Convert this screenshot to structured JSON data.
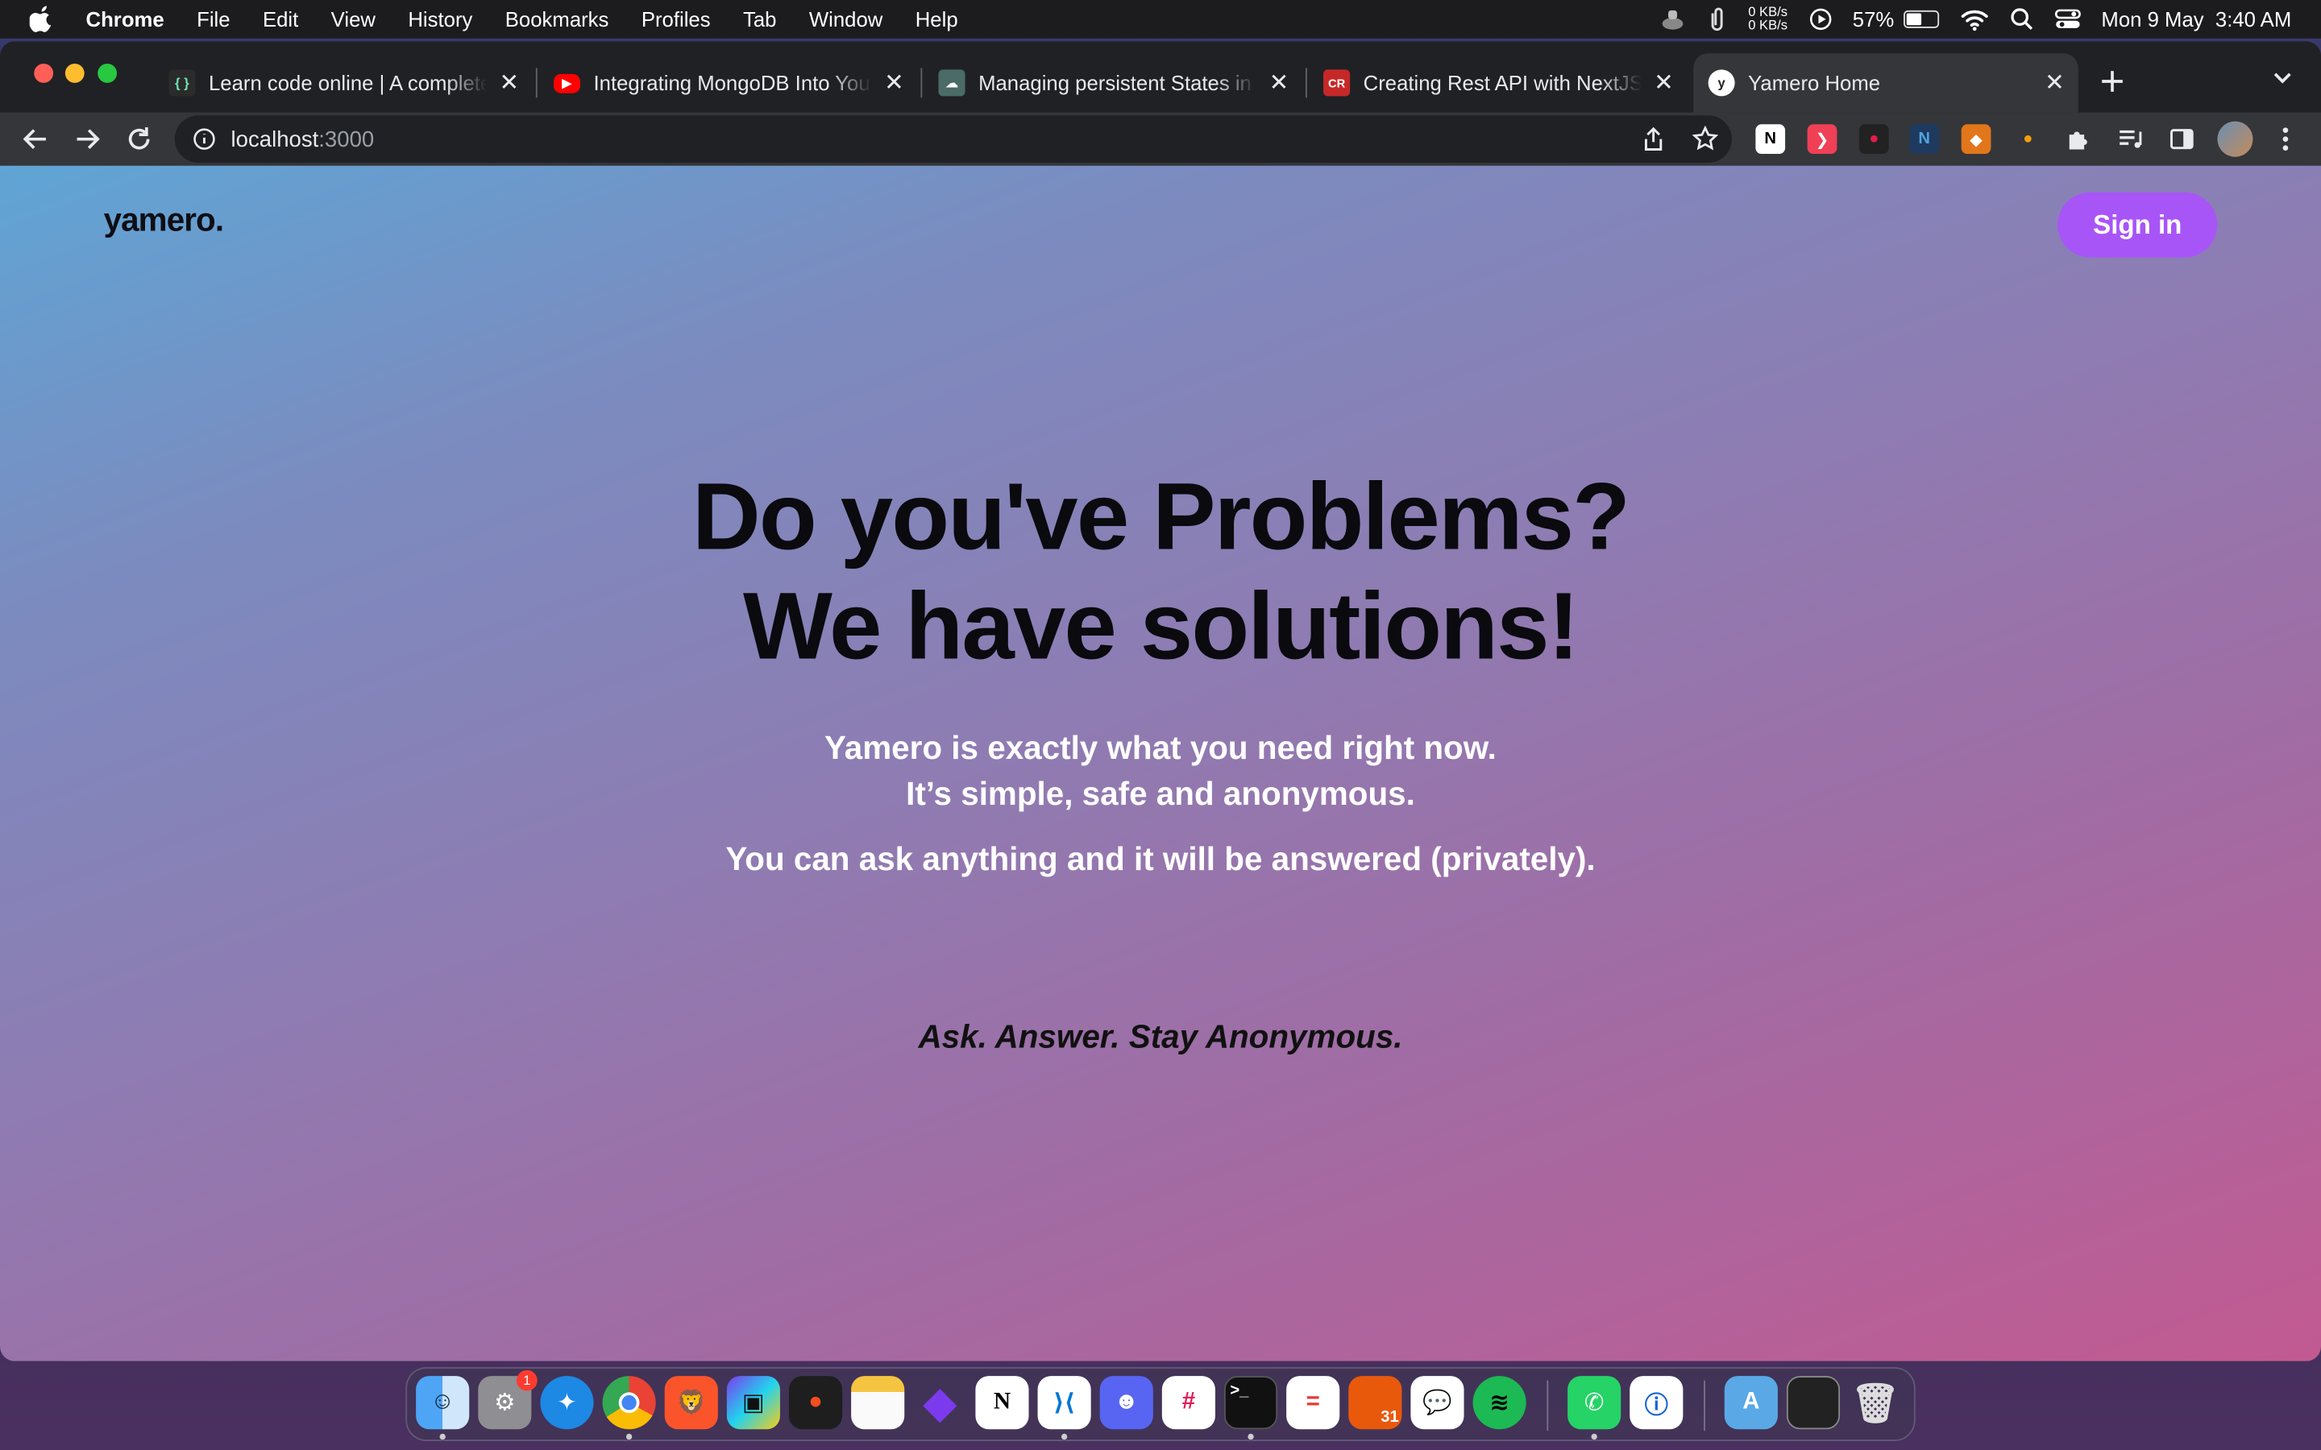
{
  "menubar": {
    "app_name": "Chrome",
    "items": [
      "File",
      "Edit",
      "View",
      "History",
      "Bookmarks",
      "Profiles",
      "Tab",
      "Window",
      "Help"
    ],
    "net_up": "0 KB/s",
    "net_down": "0 KB/s",
    "battery_percent": "57%",
    "battery_level": 0.57,
    "datetime": "Mon 9 May  3:40 AM"
  },
  "tabs": [
    {
      "title": "Learn code online | A complete",
      "icon": "scrimba-icon",
      "color": "#2b2b2b"
    },
    {
      "title": "Integrating MongoDB Into Your",
      "icon": "youtube-icon",
      "color": "#ff0000"
    },
    {
      "title": "Managing persistent States in",
      "icon": "article-icon",
      "color": "#4a6b68"
    },
    {
      "title": "Creating Rest API with NextJS.",
      "icon": "cr-icon",
      "color": "#c62828"
    },
    {
      "title": "Yamero Home",
      "icon": "yamero-icon",
      "color": "#ffffff"
    }
  ],
  "address": {
    "host": "localhost",
    "port": ":3000"
  },
  "page": {
    "logo": "yamero.",
    "signin": "Sign in",
    "hero_line1": "Do you've Problems?",
    "hero_line2": "We have solutions!",
    "sub_line1": "Yamero is exactly what you need right now.",
    "sub_line2": "It’s simple, safe and anonymous.",
    "sub_line3": "You can ask anything and it will be answered (privately).",
    "tagline": "Ask. Answer. Stay Anonymous.",
    "accent": "#a855f7"
  },
  "dock": {
    "settings_badge": "1",
    "calendar_day": "31"
  }
}
